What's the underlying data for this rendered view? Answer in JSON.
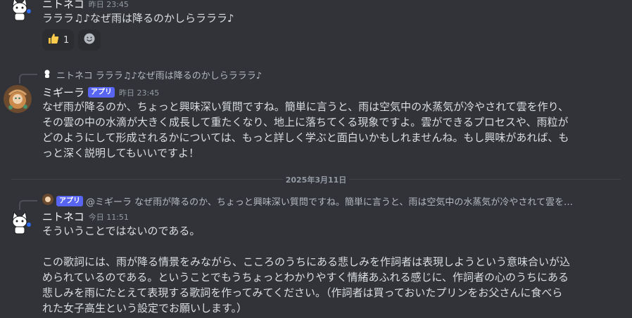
{
  "messages": [
    {
      "username": "ニトネコ",
      "timestamp": "昨日 23:45",
      "text": "ラララ♫♪なぜ雨は降るのかしらラララ♪",
      "reactions": [
        {
          "emoji": "thumbs-up",
          "count": "1"
        },
        {
          "emoji": "add-reaction"
        }
      ]
    },
    {
      "reply": {
        "username": "ニトネコ",
        "preview": "ラララ♫♪なぜ雨は降るのかしらラララ♪"
      },
      "username": "ミギーラ",
      "badge": "アプリ",
      "timestamp": "昨日 23:45",
      "text": "なぜ雨が降るのか、ちょっと興味深い質問ですね。簡単に言うと、雨は空気中の水蒸気が冷やされて雲を作り、\nその雲の中の水滴が大きく成長して重たくなり、地上に落ちてくる現象ですよ。雲ができるプロセスや、雨粒が\nどのようにして形成されるかについては、もっと詳しく学ぶと面白いかもしれませんね。もし興味があれば、も\nっと深く説明してもいいですよ！"
    },
    {
      "reply": {
        "badge": "アプリ",
        "preview": "@ミギーラ なぜ雨が降るのか、ちょっと興味深い質問ですね。簡単に言うと、雨は空気中の水蒸気が冷やされて雲を…"
      },
      "username": "ニトネコ",
      "timestamp": "今日 11:51",
      "text": "そういうことではないのである。\n\nこの歌詞には、雨が降る情景をみながら、こころのうちにある悲しみを作詞者は表現しようという意味合いが込\nめられているのである。ということでもうちょっとわかりやすく情緒あふれる感じに、作詞者の心のうちにある\n悲しみを雨にたとえて表現する歌詞を作ってみてください。（作詞者は買っておいたプリンをお父さんに食べら\nれた女子高生という設定でお願いします。）"
    }
  ],
  "date_divider": "2025年3月11日",
  "colors": {
    "background": "#313338",
    "badge": "#5865f2",
    "text": "#dbdee1"
  }
}
